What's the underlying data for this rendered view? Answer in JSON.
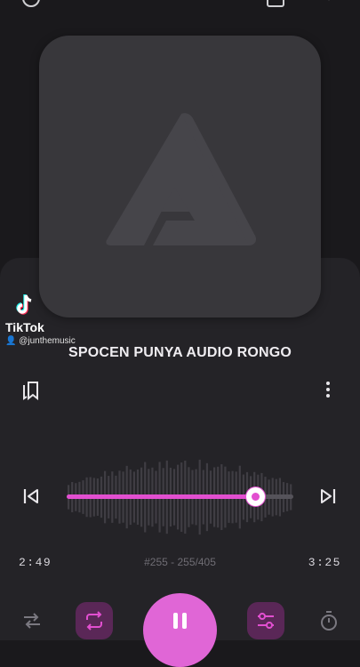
{
  "overlay": {
    "brand": "TikTok",
    "handle": "@junthemusic"
  },
  "track": {
    "title": "SPOCEN PUNYA AUDIO RONGO",
    "counter": "#255 - 255/405"
  },
  "playback": {
    "elapsed": "2:49",
    "duration": "3:25",
    "progress": 0.833
  },
  "icons": {
    "topbar": [
      "settings-icon",
      "cast-icon",
      "chevron-down-icon"
    ],
    "actions": [
      "bookmark-icon",
      "more-vertical-icon"
    ],
    "transport": [
      "skip-previous-icon",
      "skip-next-icon"
    ],
    "bottom": [
      "shuffle-icon",
      "repeat-icon",
      "pause-icon",
      "equalizer-icon",
      "sleep-timer-icon"
    ]
  },
  "colors": {
    "accent": "#e24fd0",
    "play_button": "#e066d6",
    "accent_pill": "#5a2757",
    "background": "#1a191c",
    "sheet": "#242327",
    "artwork": "#38373b"
  }
}
